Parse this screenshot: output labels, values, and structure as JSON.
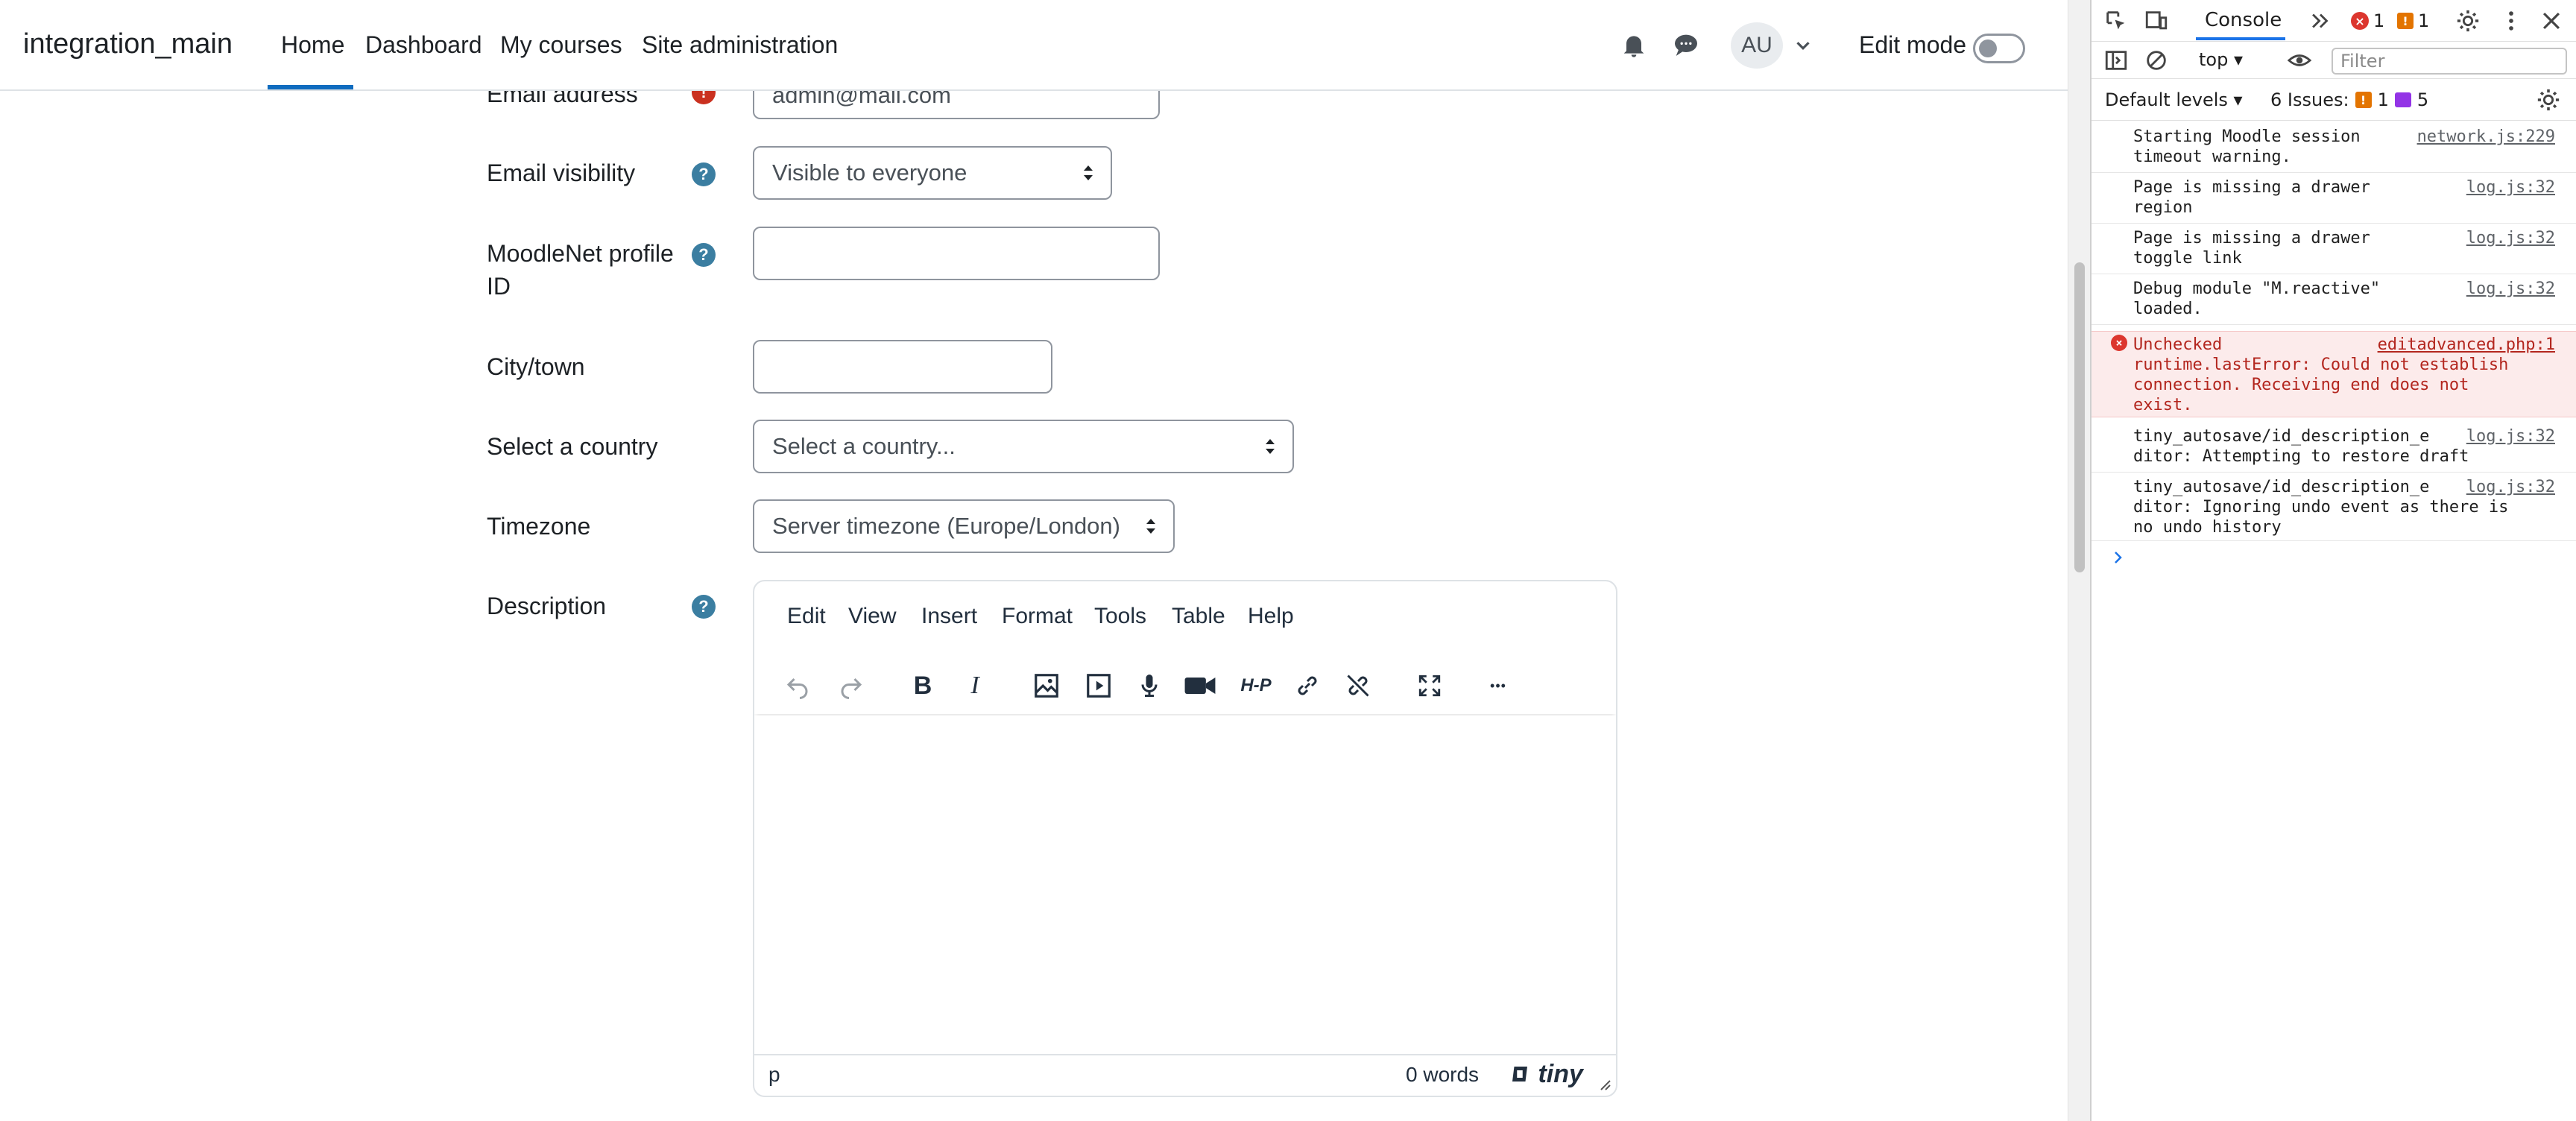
{
  "navbar": {
    "brand": "integration_main",
    "links": [
      "Home",
      "Dashboard",
      "My courses",
      "Site administration"
    ],
    "active": "Home",
    "avatar": "AU",
    "edit_mode_label": "Edit mode"
  },
  "form": {
    "email_label": "Email address",
    "email_value": "admin@mail.com",
    "email_visibility_label": "Email visibility",
    "email_visibility_value": "Visible to everyone",
    "moodlenet_label_1": "MoodleNet profile",
    "moodlenet_label_2": "ID",
    "moodlenet_value": "",
    "city_label": "City/town",
    "city_value": "",
    "country_label": "Select a country",
    "country_value": "Select a country...",
    "timezone_label": "Timezone",
    "timezone_value": "Server timezone (Europe/London)",
    "description_label": "Description",
    "help_glyph": "?",
    "required_glyph": "!"
  },
  "editor": {
    "menus": [
      "Edit",
      "View",
      "Insert",
      "Format",
      "Tools",
      "Table",
      "Help"
    ],
    "status_path": "p",
    "word_count": "0 words",
    "brand": "tiny",
    "toolbar_icons": [
      "undo-icon",
      "redo-icon",
      "bold-icon",
      "italic-icon",
      "image-icon",
      "media-icon",
      "microphone-icon",
      "video-camera-icon",
      "h5p-icon",
      "link-icon",
      "unlink-icon",
      "fullscreen-icon",
      "more-icon"
    ],
    "bold_glyph": "B",
    "italic_glyph": "I",
    "h5p_glyph": "H-P",
    "more_glyph": "•••"
  },
  "devtools": {
    "tab": "Console",
    "error_count": "1",
    "warning_count": "1",
    "context": "top",
    "filter_placeholder": "Filter",
    "levels": "Default levels",
    "issues_label": "6 Issues:",
    "issues_warn": "1",
    "issues_info": "5",
    "logs": [
      {
        "msg": "Starting Moodle session\ntimeout warning.",
        "src": "network.js:229",
        "level": "info"
      },
      {
        "msg": "Page is missing a drawer\nregion",
        "src": "log.js:32",
        "level": "info"
      },
      {
        "msg": "Page is missing a drawer\ntoggle link",
        "src": "log.js:32",
        "level": "info"
      },
      {
        "msg": "Debug module \"M.reactive\"\nloaded.",
        "src": "log.js:32",
        "level": "info"
      },
      {
        "msg": "Unchecked\nruntime.lastError: Could not establish\nconnection. Receiving end does not\nexist.",
        "src": "editadvanced.php:1",
        "level": "error"
      },
      {
        "msg": "tiny_autosave/id_description_e\nditor: Attempting to restore draft",
        "src": "log.js:32",
        "level": "info"
      },
      {
        "msg": "tiny_autosave/id_description_e\nditor: Ignoring undo event as there is\nno undo history",
        "src": "log.js:32",
        "level": "info"
      }
    ]
  }
}
